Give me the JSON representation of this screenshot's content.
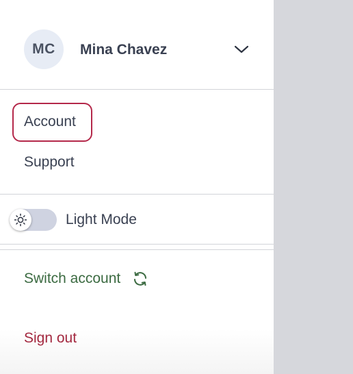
{
  "user": {
    "initials": "MC",
    "name": "Mina Chavez"
  },
  "menu": {
    "account_label": "Account",
    "support_label": "Support"
  },
  "theme": {
    "label": "Light Mode",
    "enabled": false
  },
  "actions": {
    "switch_account_label": "Switch account",
    "sign_out_label": "Sign out"
  },
  "colors": {
    "text": "#3a4152",
    "switch_account": "#3c6b42",
    "sign_out": "#a3283f",
    "focus_ring": "#b4284a",
    "avatar_bg": "#e7ecf5",
    "backdrop": "#d6d7dc"
  },
  "icons": {
    "header_chevron": "chevron-down-icon",
    "toggle_knob": "sun-icon",
    "switch_account": "refresh-icon"
  }
}
